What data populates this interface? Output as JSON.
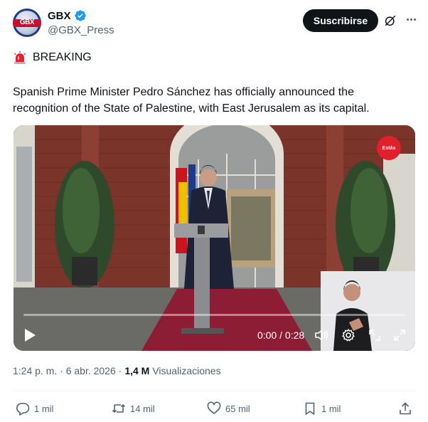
{
  "author": {
    "display_name": "GBX",
    "handle": "@GBX_Press",
    "avatar_text": "GBX"
  },
  "header": {
    "subscribe_label": "Suscribirse"
  },
  "post": {
    "tag_label": "BREAKING",
    "text": "Spanish Prime Minister Pedro Sánchez has officially announced the recognition of the State of Palestine, with East Jerusalem as its capital."
  },
  "video": {
    "time_display": "0:00 / 0:28",
    "progress": 0,
    "logo_text": "Estás"
  },
  "meta": {
    "timestamp": "1:24 p. m. · 6 abr. 2026 ·",
    "views_count": "1,4 M",
    "views_label": "Visualizaciones"
  },
  "actions": {
    "replies": "1 mil",
    "reposts": "14 mil",
    "likes": "65 mil",
    "bookmarks": "1 mil"
  },
  "colors": {
    "accent": "#1d9bf0",
    "text": "#0f1419",
    "secondary": "#536471"
  }
}
